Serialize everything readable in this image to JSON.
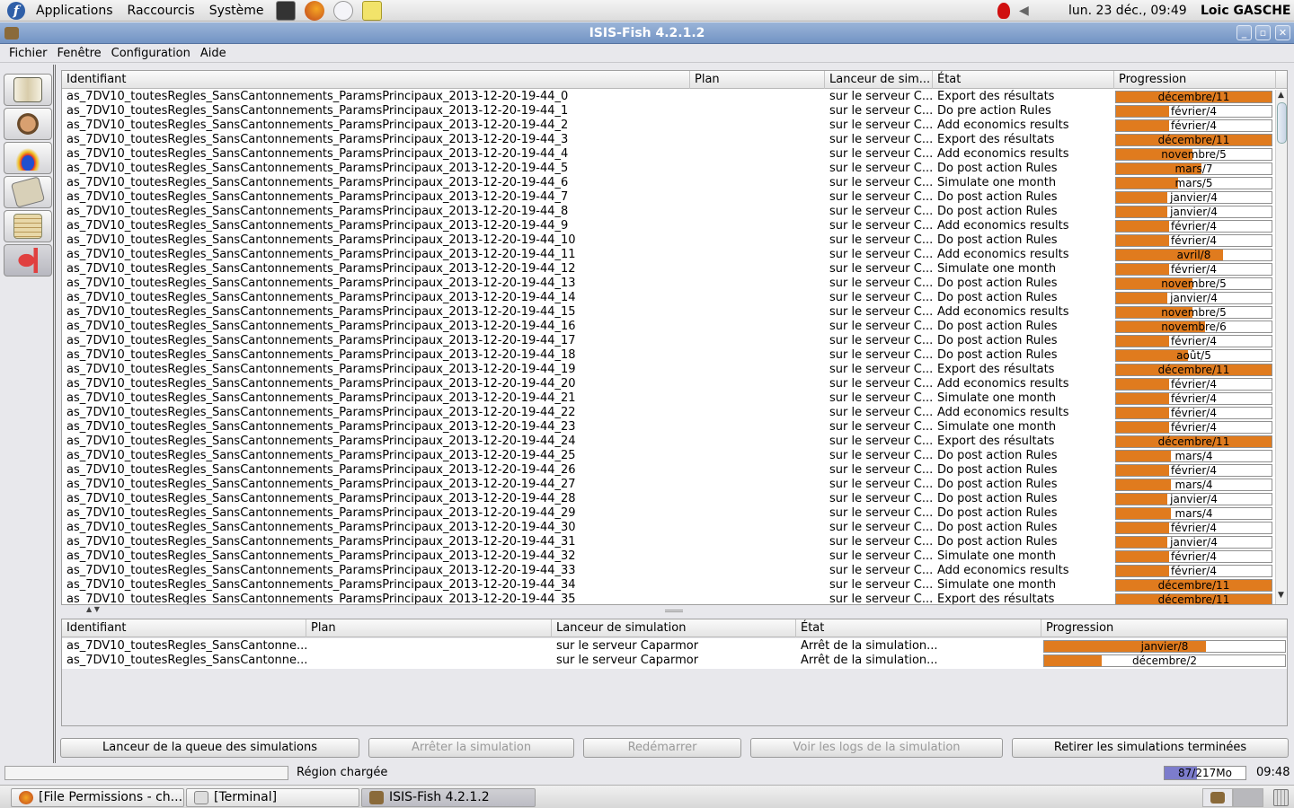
{
  "panel": {
    "menus": [
      "Applications",
      "Raccourcis",
      "Système"
    ],
    "launchers": [
      "terminal-icon",
      "firefox-icon",
      "mail-icon",
      "text-editor-icon"
    ],
    "clock": "lun. 23 déc., 09:49",
    "user": "Loic GASCHE"
  },
  "window": {
    "title": "ISIS-Fish 4.2.1.2"
  },
  "menubar": [
    "Fichier",
    "Fenêtre",
    "Configuration",
    "Aide"
  ],
  "sidebar": [
    {
      "icon": "book-icon"
    },
    {
      "icon": "fisherman-icon"
    },
    {
      "icon": "region-icon"
    },
    {
      "icon": "calculator-icon"
    },
    {
      "icon": "notes-icon"
    },
    {
      "icon": "fish-icon"
    }
  ],
  "upper_table": {
    "headers": [
      "Identifiant",
      "Plan",
      "Lanceur de sim...",
      "État",
      "Progression"
    ],
    "rows": [
      [
        "as_7DV10_toutesRegles_SansCantonnements_ParamsPrincipaux_2013-12-20-19-44_0",
        "",
        "sur le serveur C...",
        "Export des résultats",
        "décembre/11",
        1.0
      ],
      [
        "as_7DV10_toutesRegles_SansCantonnements_ParamsPrincipaux_2013-12-20-19-44_1",
        "",
        "sur le serveur C...",
        "Do pre action Rules",
        "février/4",
        0.34
      ],
      [
        "as_7DV10_toutesRegles_SansCantonnements_ParamsPrincipaux_2013-12-20-19-44_2",
        "",
        "sur le serveur C...",
        "Add economics results",
        "février/4",
        0.34
      ],
      [
        "as_7DV10_toutesRegles_SansCantonnements_ParamsPrincipaux_2013-12-20-19-44_3",
        "",
        "sur le serveur C...",
        "Export des résultats",
        "décembre/11",
        1.0
      ],
      [
        "as_7DV10_toutesRegles_SansCantonnements_ParamsPrincipaux_2013-12-20-19-44_4",
        "",
        "sur le serveur C...",
        "Add economics results",
        "novembre/5",
        0.49
      ],
      [
        "as_7DV10_toutesRegles_SansCantonnements_ParamsPrincipaux_2013-12-20-19-44_5",
        "",
        "sur le serveur C...",
        "Do post action Rules",
        "mars/7",
        0.55
      ],
      [
        "as_7DV10_toutesRegles_SansCantonnements_ParamsPrincipaux_2013-12-20-19-44_6",
        "",
        "sur le serveur C...",
        "Simulate one month",
        "mars/5",
        0.4
      ],
      [
        "as_7DV10_toutesRegles_SansCantonnements_ParamsPrincipaux_2013-12-20-19-44_7",
        "",
        "sur le serveur C...",
        "Do post action Rules",
        "janvier/4",
        0.33
      ],
      [
        "as_7DV10_toutesRegles_SansCantonnements_ParamsPrincipaux_2013-12-20-19-44_8",
        "",
        "sur le serveur C...",
        "Do post action Rules",
        "janvier/4",
        0.33
      ],
      [
        "as_7DV10_toutesRegles_SansCantonnements_ParamsPrincipaux_2013-12-20-19-44_9",
        "",
        "sur le serveur C...",
        "Add economics results",
        "février/4",
        0.34
      ],
      [
        "as_7DV10_toutesRegles_SansCantonnements_ParamsPrincipaux_2013-12-20-19-44_10",
        "",
        "sur le serveur C...",
        "Do post action Rules",
        "février/4",
        0.34
      ],
      [
        "as_7DV10_toutesRegles_SansCantonnements_ParamsPrincipaux_2013-12-20-19-44_11",
        "",
        "sur le serveur C...",
        "Add economics results",
        "avril/8",
        0.69
      ],
      [
        "as_7DV10_toutesRegles_SansCantonnements_ParamsPrincipaux_2013-12-20-19-44_12",
        "",
        "sur le serveur C...",
        "Simulate one month",
        "février/4",
        0.34
      ],
      [
        "as_7DV10_toutesRegles_SansCantonnements_ParamsPrincipaux_2013-12-20-19-44_13",
        "",
        "sur le serveur C...",
        "Do post action Rules",
        "novembre/5",
        0.49
      ],
      [
        "as_7DV10_toutesRegles_SansCantonnements_ParamsPrincipaux_2013-12-20-19-44_14",
        "",
        "sur le serveur C...",
        "Do post action Rules",
        "janvier/4",
        0.33
      ],
      [
        "as_7DV10_toutesRegles_SansCantonnements_ParamsPrincipaux_2013-12-20-19-44_15",
        "",
        "sur le serveur C...",
        "Add economics results",
        "novembre/5",
        0.49
      ],
      [
        "as_7DV10_toutesRegles_SansCantonnements_ParamsPrincipaux_2013-12-20-19-44_16",
        "",
        "sur le serveur C...",
        "Do post action Rules",
        "novembre/6",
        0.57
      ],
      [
        "as_7DV10_toutesRegles_SansCantonnements_ParamsPrincipaux_2013-12-20-19-44_17",
        "",
        "sur le serveur C...",
        "Do post action Rules",
        "février/4",
        0.34
      ],
      [
        "as_7DV10_toutesRegles_SansCantonnements_ParamsPrincipaux_2013-12-20-19-44_18",
        "",
        "sur le serveur C...",
        "Do post action Rules",
        "août/5",
        0.46
      ],
      [
        "as_7DV10_toutesRegles_SansCantonnements_ParamsPrincipaux_2013-12-20-19-44_19",
        "",
        "sur le serveur C...",
        "Export des résultats",
        "décembre/11",
        1.0
      ],
      [
        "as_7DV10_toutesRegles_SansCantonnements_ParamsPrincipaux_2013-12-20-19-44_20",
        "",
        "sur le serveur C...",
        "Add economics results",
        "février/4",
        0.34
      ],
      [
        "as_7DV10_toutesRegles_SansCantonnements_ParamsPrincipaux_2013-12-20-19-44_21",
        "",
        "sur le serveur C...",
        "Simulate one month",
        "février/4",
        0.34
      ],
      [
        "as_7DV10_toutesRegles_SansCantonnements_ParamsPrincipaux_2013-12-20-19-44_22",
        "",
        "sur le serveur C...",
        "Add economics results",
        "février/4",
        0.34
      ],
      [
        "as_7DV10_toutesRegles_SansCantonnements_ParamsPrincipaux_2013-12-20-19-44_23",
        "",
        "sur le serveur C...",
        "Simulate one month",
        "février/4",
        0.34
      ],
      [
        "as_7DV10_toutesRegles_SansCantonnements_ParamsPrincipaux_2013-12-20-19-44_24",
        "",
        "sur le serveur C...",
        "Export des résultats",
        "décembre/11",
        1.0
      ],
      [
        "as_7DV10_toutesRegles_SansCantonnements_ParamsPrincipaux_2013-12-20-19-44_25",
        "",
        "sur le serveur C...",
        "Do post action Rules",
        "mars/4",
        0.35
      ],
      [
        "as_7DV10_toutesRegles_SansCantonnements_ParamsPrincipaux_2013-12-20-19-44_26",
        "",
        "sur le serveur C...",
        "Do post action Rules",
        "février/4",
        0.34
      ],
      [
        "as_7DV10_toutesRegles_SansCantonnements_ParamsPrincipaux_2013-12-20-19-44_27",
        "",
        "sur le serveur C...",
        "Do post action Rules",
        "mars/4",
        0.35
      ],
      [
        "as_7DV10_toutesRegles_SansCantonnements_ParamsPrincipaux_2013-12-20-19-44_28",
        "",
        "sur le serveur C...",
        "Do post action Rules",
        "janvier/4",
        0.33
      ],
      [
        "as_7DV10_toutesRegles_SansCantonnements_ParamsPrincipaux_2013-12-20-19-44_29",
        "",
        "sur le serveur C...",
        "Do post action Rules",
        "mars/4",
        0.35
      ],
      [
        "as_7DV10_toutesRegles_SansCantonnements_ParamsPrincipaux_2013-12-20-19-44_30",
        "",
        "sur le serveur C...",
        "Do post action Rules",
        "février/4",
        0.34
      ],
      [
        "as_7DV10_toutesRegles_SansCantonnements_ParamsPrincipaux_2013-12-20-19-44_31",
        "",
        "sur le serveur C...",
        "Do post action Rules",
        "janvier/4",
        0.33
      ],
      [
        "as_7DV10_toutesRegles_SansCantonnements_ParamsPrincipaux_2013-12-20-19-44_32",
        "",
        "sur le serveur C...",
        "Simulate one month",
        "février/4",
        0.34
      ],
      [
        "as_7DV10_toutesRegles_SansCantonnements_ParamsPrincipaux_2013-12-20-19-44_33",
        "",
        "sur le serveur C...",
        "Add economics results",
        "février/4",
        0.34
      ],
      [
        "as_7DV10_toutesRegles_SansCantonnements_ParamsPrincipaux_2013-12-20-19-44_34",
        "",
        "sur le serveur C...",
        "Simulate one month",
        "décembre/11",
        1.0
      ],
      [
        "as_7DV10_toutesRegles_SansCantonnements_ParamsPrincipaux_2013-12-20-19-44_35",
        "",
        "sur le serveur C...",
        "Export des résultats",
        "décembre/11",
        1.0
      ]
    ]
  },
  "lower_table": {
    "headers": [
      "Identifiant",
      "Plan",
      "Lanceur de simulation",
      "État",
      "Progression"
    ],
    "rows": [
      [
        "as_7DV10_toutesRegles_SansCantonne...",
        "",
        "sur le serveur Caparmor",
        "Arrêt de la simulation...",
        "janvier/8",
        0.67
      ],
      [
        "as_7DV10_toutesRegles_SansCantonne...",
        "",
        "sur le serveur Caparmor",
        "Arrêt de la simulation...",
        "décembre/2",
        0.24
      ]
    ]
  },
  "buttons": {
    "queue": "Lanceur de la queue des simulations",
    "stop": "Arrêter la simulation",
    "restart": "Redémarrer",
    "logs": "Voir les logs de la simulation",
    "remove": "Retirer les simulations terminées"
  },
  "status": {
    "text": "Région chargée",
    "memory": "87/217Mo",
    "memory_fraction": 0.4,
    "time": "09:48"
  },
  "taskbar": [
    {
      "label": "[File Permissions - ch...",
      "icon": "firefox-icon"
    },
    {
      "label": "[Terminal]",
      "icon": "terminal-icon"
    },
    {
      "label": "ISIS-Fish 4.2.1.2",
      "icon": "isis-icon"
    }
  ],
  "colors": {
    "progress_fill": "#e07b1e",
    "titlebar": "#7f9fcc",
    "memory_fill": "#7c7ccc"
  }
}
